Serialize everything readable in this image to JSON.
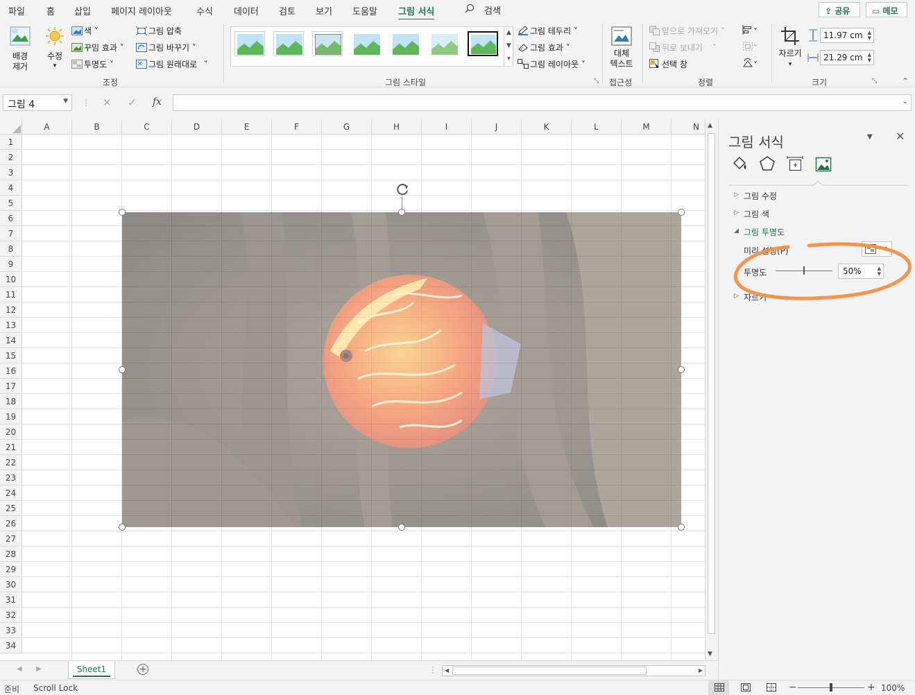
{
  "tabs": [
    "파일",
    "홈",
    "삽입",
    "페이지 레이아웃",
    "수식",
    "데이터",
    "검토",
    "보기",
    "도움말",
    "그림 서식"
  ],
  "active_tab": "그림 서식",
  "search_label": "검색",
  "share_label": "공유",
  "memo_label": "메모",
  "ribbon": {
    "adjust": {
      "remove_bg": "배경\n제거",
      "correct": "수정",
      "color": "색",
      "artistic": "꾸밈 효과",
      "transparency": "투명도",
      "compress": "그림 압축",
      "change": "그림 바꾸기",
      "reset": "그림 원래대로",
      "group": "조정"
    },
    "styles": {
      "border": "그림 테두리",
      "effects": "그림 효과",
      "layout": "그림 레이아웃",
      "group": "그림 스타일"
    },
    "access": {
      "alt_text": "대체\n텍스트",
      "group": "접근성"
    },
    "arrange": {
      "forward": "앞으로 가져오기",
      "backward": "뒤로 보내기",
      "selection": "선택 창",
      "group": "정렬"
    },
    "size": {
      "crop": "자르기",
      "height": "11.97 cm",
      "width": "21.29 cm",
      "group": "크기"
    }
  },
  "formula": {
    "name_box": "그림 4",
    "fx": "fx"
  },
  "columns": [
    "A",
    "B",
    "C",
    "D",
    "E",
    "F",
    "G",
    "H",
    "I",
    "J",
    "K",
    "L",
    "M",
    "N"
  ],
  "rows": [
    "1",
    "2",
    "3",
    "4",
    "5",
    "6",
    "7",
    "8",
    "9",
    "10",
    "11",
    "12",
    "13",
    "14",
    "15",
    "16",
    "17",
    "18",
    "19",
    "20",
    "21",
    "22",
    "23",
    "24",
    "25",
    "26",
    "27",
    "28",
    "29",
    "30",
    "31",
    "32",
    "33",
    "34"
  ],
  "pane": {
    "title": "그림 서식",
    "sections": [
      "그림 수정",
      "그림 색",
      "그림 투명도",
      "자르기"
    ],
    "preset_label": "미리 설정(P)",
    "transparency_label": "투명도",
    "transparency_value": "50%",
    "transparency_fraction": 0.5
  },
  "sheet_tab": "Sheet1",
  "status": {
    "ready": "준비",
    "scroll_lock": "Scroll Lock",
    "zoom": "100%"
  },
  "colors": {
    "accent": "#217346",
    "highlight": "#f7944a"
  }
}
